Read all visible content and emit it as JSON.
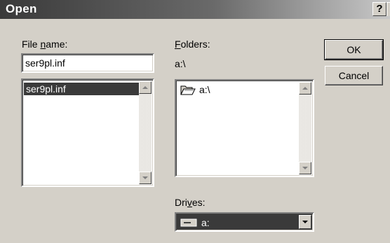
{
  "window": {
    "title": "Open",
    "help_glyph": "?"
  },
  "file_name": {
    "label_prefix": "File ",
    "label_accel": "n",
    "label_suffix": "ame:",
    "value": "ser9pl.inf",
    "list": [
      "ser9pl.inf"
    ]
  },
  "folders": {
    "label_accel": "F",
    "label_suffix": "olders:",
    "current_path": "a:\\",
    "list": [
      "a:\\"
    ]
  },
  "drives": {
    "label_prefix": "Dri",
    "label_accel": "v",
    "label_suffix": "es:",
    "selected": "a:"
  },
  "buttons": {
    "ok": "OK",
    "cancel": "Cancel"
  },
  "icons": {
    "folder": "open-folder-icon",
    "drive": "floppy-drive-icon",
    "scroll_up": "scroll-up-arrow-icon",
    "scroll_down": "scroll-down-arrow-icon",
    "dropdown": "chevron-down-icon"
  },
  "colors": {
    "titlebar": "#3a3a3a",
    "face": "#d4d0c8",
    "selection": "#3a3a3a"
  }
}
